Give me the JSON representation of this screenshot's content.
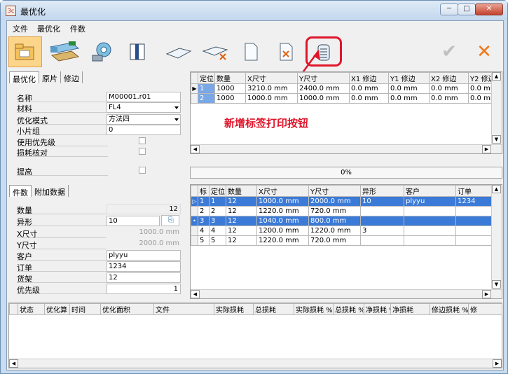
{
  "window": {
    "title": "最优化",
    "app_icon": "3c",
    "min": "─",
    "max": "□",
    "close": "✕"
  },
  "menu": [
    "文件",
    "最优化",
    "件数"
  ],
  "toolbar": {
    "icons": [
      "open-folder-icon",
      "material-stack-icon",
      "cutting-disc-icon",
      "column-icon",
      "sheet-icon",
      "sheet-cut-icon",
      "new-doc-icon",
      "delete-doc-icon",
      "label-print-icon",
      "ok-check-icon",
      "cancel-x-icon"
    ],
    "check": "✔",
    "cancel": "✕"
  },
  "annotation": "新增标签打印按钮",
  "top_tabs": [
    "最优化",
    "原片",
    "修边"
  ],
  "opt_fields": {
    "name": {
      "label": "名称",
      "value": "M00001.r01"
    },
    "material": {
      "label": "材料",
      "value": "FL4"
    },
    "mode": {
      "label": "优化模式",
      "value": "方法四"
    },
    "small_group": {
      "label": "小片组",
      "value": "0"
    },
    "use_priority": {
      "label": "使用优先级"
    },
    "loss_check": {
      "label": "损耗核对"
    },
    "raise": {
      "label": "提高"
    }
  },
  "stock_grid": {
    "headers": [
      "定位",
      "数量",
      "X尺寸",
      "Y尺寸",
      "X1 修边",
      "Y1 修边",
      "X2 修边",
      "Y2 修边"
    ],
    "rows": [
      [
        "1",
        "1000",
        "3210.0 mm",
        "2400.0 mm",
        "0.0 mm",
        "0.0 mm",
        "0.0 mm",
        "0.0 mm"
      ],
      [
        "2",
        "1000",
        "1000.0 mm",
        "1000.0 mm",
        "0.0 mm",
        "0.0 mm",
        "0.0 mm",
        "0.0 mm"
      ]
    ]
  },
  "progress": "0%",
  "bottom_tabs": [
    "件数",
    "附加数据"
  ],
  "part_fields": {
    "qty": {
      "label": "数量",
      "value": "12"
    },
    "shape": {
      "label": "异形",
      "value": "10"
    },
    "x": {
      "label": "X尺寸",
      "value": "1000.0 mm"
    },
    "y": {
      "label": "Y尺寸",
      "value": "2000.0 mm"
    },
    "customer": {
      "label": "客户",
      "value": "plyyu"
    },
    "order": {
      "label": "订单",
      "value": "1234"
    },
    "rack": {
      "label": "货架",
      "value": "12"
    },
    "priority": {
      "label": "优先级",
      "value": "1"
    }
  },
  "parts_grid": {
    "headers": [
      "标",
      "定位",
      "数量",
      "X尺寸",
      "Y尺寸",
      "异形",
      "客户",
      "订单"
    ],
    "rows": [
      [
        "1",
        "1",
        "12",
        "1000.0 mm",
        "2000.0 mm",
        "10",
        "plyyu",
        "1234"
      ],
      [
        "2",
        "2",
        "12",
        "1220.0 mm",
        "720.0 mm",
        "",
        "",
        ""
      ],
      [
        "3",
        "3",
        "12",
        "1040.0 mm",
        "800.0 mm",
        "",
        "",
        ""
      ],
      [
        "4",
        "4",
        "12",
        "1200.0 mm",
        "1220.0 mm",
        "3",
        "",
        ""
      ],
      [
        "5",
        "5",
        "12",
        "1220.0 mm",
        "720.0 mm",
        "",
        "",
        ""
      ]
    ],
    "selected_rows": [
      0,
      2
    ]
  },
  "result_grid": {
    "headers": [
      "状态",
      "优化算",
      "时间",
      "优化面积",
      "文件",
      "实际损耗",
      "总损耗",
      "实际损耗 %",
      "总损耗 %",
      "净损耗 %",
      "净损耗",
      "修边损耗 %",
      "修"
    ]
  },
  "colors": {
    "selection": "#3b7ad7",
    "annotation": "#e0152a",
    "title_bg": "#c9dcf0"
  }
}
